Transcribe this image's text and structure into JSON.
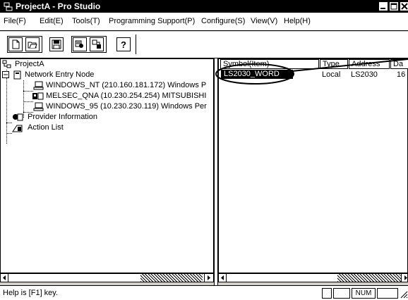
{
  "window": {
    "title": "ProjectA - Pro Studio",
    "controls": [
      "minimize-icon",
      "maximize-icon",
      "close-icon"
    ]
  },
  "menubar": {
    "items": [
      {
        "label": "File(F)"
      },
      {
        "label": "Edit(E)"
      },
      {
        "label": "Tools(T)"
      },
      {
        "label": "Programming Support(P)"
      },
      {
        "label": "Configure(S)"
      },
      {
        "label": "View(V)"
      },
      {
        "label": "Help(H)"
      }
    ]
  },
  "toolbar": {
    "buttons": [
      "new-icon",
      "open-icon",
      "save-icon",
      "build-icon",
      "transfer-icon",
      "help-icon"
    ]
  },
  "tree": {
    "root": {
      "label": "ProjectA"
    },
    "network_node": {
      "label": "Network Entry Node"
    },
    "nodes": [
      {
        "label": "WINDOWS_NT (210.160.181.172) Windows P"
      },
      {
        "label": "MELSEC_QNA (10.230.254.254) MITSUBISHI"
      },
      {
        "label": "WINDOWS_95 (10.230.230.119) Windows Per"
      }
    ],
    "provider": {
      "label": "Provider Information"
    },
    "actions": {
      "label": "Action List"
    }
  },
  "list": {
    "columns": [
      "Symbol(Item)",
      "Type",
      "Address",
      "Da"
    ],
    "rows": [
      {
        "symbol": "LS2030_WORD",
        "type": "Local",
        "address": "LS2030",
        "data": "16"
      }
    ]
  },
  "statusbar": {
    "help_text": "Help is [F1] key.",
    "num": "NUM"
  }
}
